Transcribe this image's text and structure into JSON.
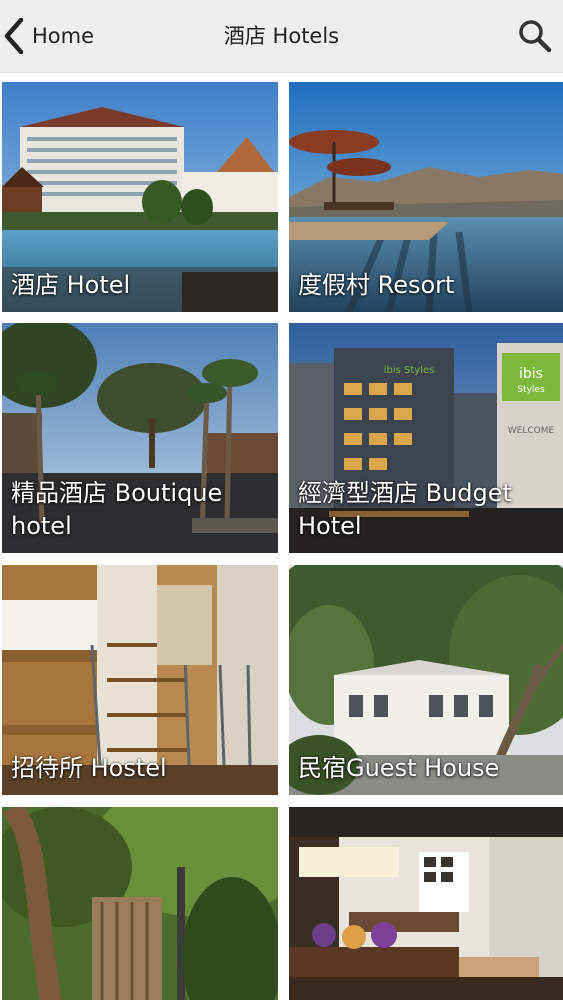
{
  "header": {
    "back_label": "Home",
    "title": "酒店 Hotels",
    "back_icon": "chevron-left-icon",
    "search_icon": "search-icon"
  },
  "categories": [
    {
      "label": "酒店 Hotel"
    },
    {
      "label": "度假村 Resort"
    },
    {
      "label": "精品酒店 Boutique hotel"
    },
    {
      "label": "經濟型酒店 Budget Hotel"
    },
    {
      "label": "招待所 Hostel"
    },
    {
      "label": "民宿Guest House"
    },
    {
      "label": ""
    },
    {
      "label": ""
    }
  ]
}
